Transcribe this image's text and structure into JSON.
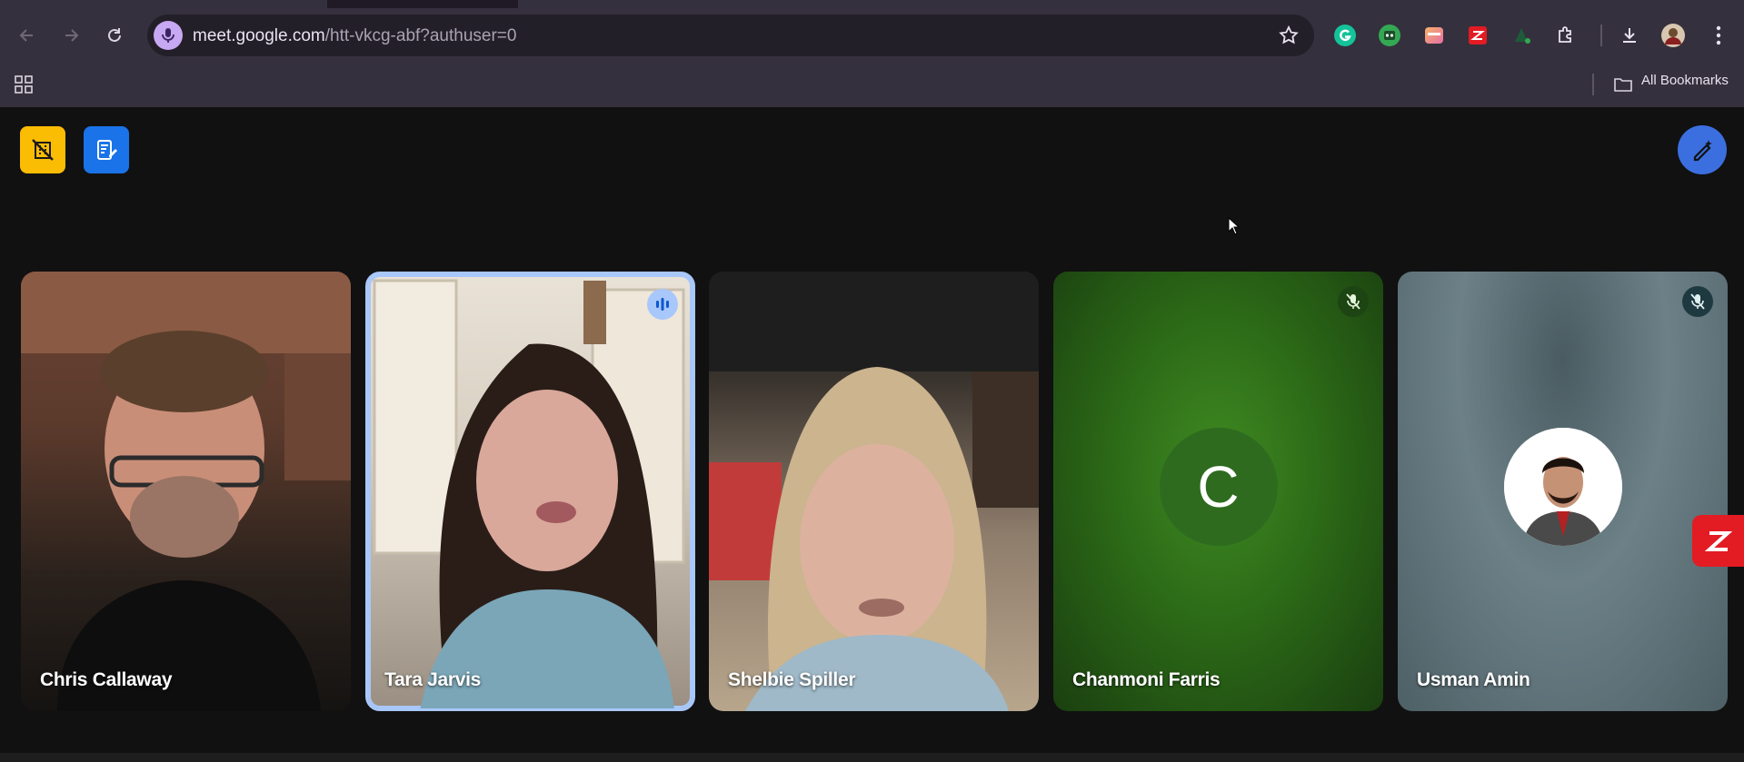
{
  "browser": {
    "url_host": "meet.google.com",
    "url_path": "/htt-vkcg-abf?authuser=0",
    "bookmarks_label": "All Bookmarks",
    "extensions": [
      "grammarly-icon",
      "robot-extension-icon",
      "gradient-extension-icon",
      "zoho-extension-icon",
      "dark-extension-icon",
      "puzzle-extensions-icon"
    ]
  },
  "meet": {
    "participants": [
      {
        "name": "Chris Callaway",
        "muted": false,
        "speaking": false
      },
      {
        "name": "Tara Jarvis",
        "muted": false,
        "speaking": true
      },
      {
        "name": "Shelbie Spiller",
        "muted": false,
        "speaking": false
      },
      {
        "name": "Chanmoni Farris",
        "muted": true,
        "speaking": false,
        "avatar_letter": "C"
      },
      {
        "name": "Usman Amin",
        "muted": true,
        "speaking": false
      }
    ]
  },
  "colors": {
    "chrome_bg": "#35303d",
    "meet_bg": "#111111",
    "active_outline": "#a8c7fa",
    "yellow_button": "#fbbc04",
    "blue_button": "#1a73e8"
  }
}
